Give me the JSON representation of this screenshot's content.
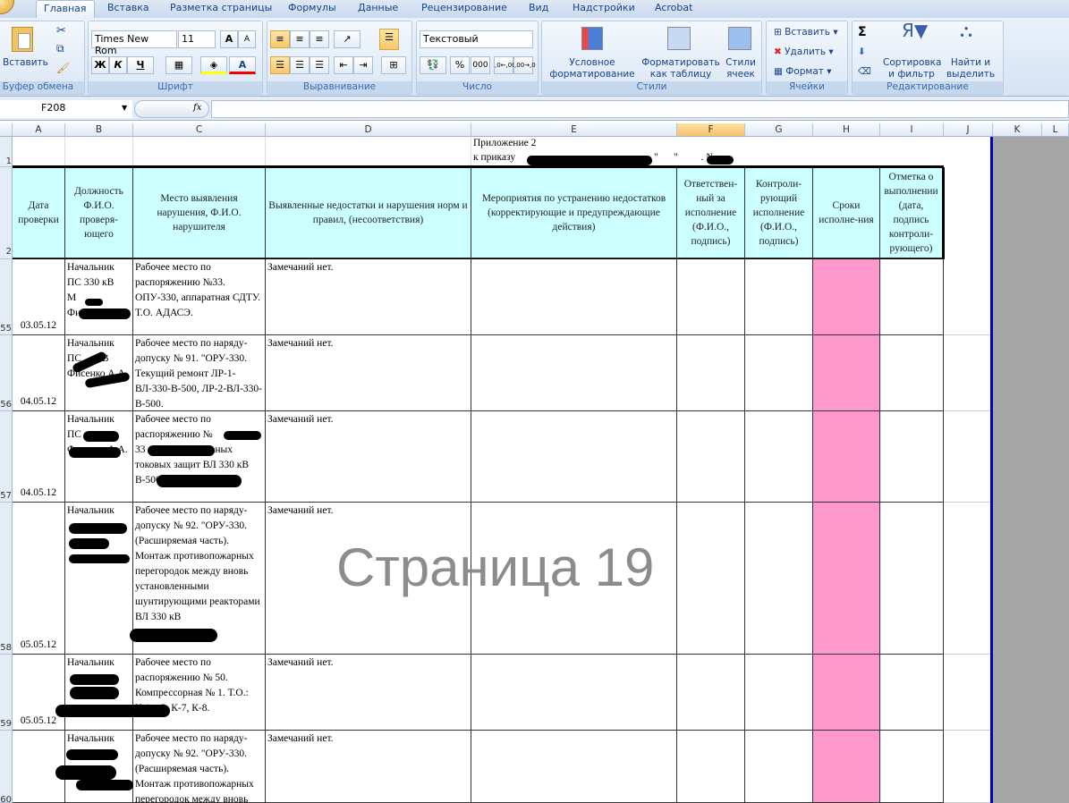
{
  "ribbon_tabs": [
    "Главная",
    "Вставка",
    "Разметка страницы",
    "Формулы",
    "Данные",
    "Рецензирование",
    "Вид",
    "Надстройки",
    "Acrobat"
  ],
  "active_tab": "Главная",
  "clipboard": {
    "paste": "Вставить",
    "group": "Буфер обмена"
  },
  "font": {
    "name": "Times New Rom",
    "size": "11",
    "bold": "Ж",
    "italic": "К",
    "underline": "Ч",
    "grow": "A",
    "shrink": "A",
    "color": "A",
    "group": "Шрифт"
  },
  "alignment": {
    "group": "Выравнивание"
  },
  "number": {
    "format": "Текстовый",
    "percent": "%",
    "thousands": "000",
    "inc_dec": ",0←,00",
    "dec_dec": ",00→,0",
    "group": "Число"
  },
  "styles": {
    "conditional": "Условное форматирование",
    "format_table": "Форматировать как таблицу",
    "cell_styles": "Стили ячеек",
    "group": "Стили"
  },
  "cells": {
    "insert": "Вставить",
    "delete": "Удалить",
    "format": "Формат",
    "group": "Ячейки"
  },
  "editing": {
    "sum": "Σ",
    "sort": "Сортировка и фильтр",
    "find": "Найти и выделить",
    "group": "Редактирование"
  },
  "formula_bar": {
    "name_box": "F208",
    "fx": "fx",
    "value": ""
  },
  "columns": [
    "A",
    "B",
    "C",
    "D",
    "E",
    "F",
    "G",
    "H",
    "I",
    "J",
    "K",
    "L"
  ],
  "selected_column": "F",
  "row1": {
    "num": "1",
    "line1": "Приложение 2",
    "line2": "к  приказу",
    "line2_tail": "\"      \"         . №"
  },
  "header_row": {
    "num": "2",
    "cols": [
      "Дата проверки",
      "Должность Ф.И.О. проверя-ющего",
      "Место выявления нарушения, Ф.И.О. нарушителя",
      "Выявленные недостатки и нарушения норм и правил, (несоответствия)",
      "Мероприятия по устранению недостатков (корректирующие и предупреждающие действия)",
      "Ответствен-ный за исполнение (Ф.И.О., подпись)",
      "Контроли-рующий исполнение (Ф.И.О., подпись)",
      "Сроки исполне-ния",
      "Отметка о выполнении (дата, подпись контроли-рующего)"
    ]
  },
  "rows": [
    {
      "num": "55",
      "date": "03.05.12",
      "who": "Начальник ПС 330 кВ М         Фисенко А.А.",
      "place": "Рабочее место по распоряжению №33. ОПУ-330, аппаратная СДТУ. Т.О. АДАСЭ.",
      "finding": "Замечаний нет."
    },
    {
      "num": "56",
      "date": "04.05.12",
      "who": "Начальник ПС      кВ   Фисенко А.А.",
      "place": "Рабочее место по наряду-допуску № 91. \"ОРУ-330. Текущий ремонт ЛР-1-ВЛ-330-В-500, ЛР-2-ВЛ-330-В-500.",
      "finding": "Замечаний нет."
    },
    {
      "num": "57",
      "date": "04.05.12",
      "who": "Начальник ПС     Фисенко А.А.",
      "place": "Рабочее место по распоряжению №        33                резервных токовых защит ВЛ 330 кВ В-500 -                     \"О\".",
      "finding": "Замечаний нет."
    },
    {
      "num": "58",
      "date": "05.05.12",
      "who": "Начальник",
      "place": "Рабочее место по наряду-допуску № 92. \"ОРУ-330. (Расширяемая часть). Монтаж противопожарных перегородок между вновь установленными шунтирующими реакторами ВЛ 330 кВ",
      "finding": "Замечаний нет."
    },
    {
      "num": "59",
      "date": "05.05.12",
      "who": "Начальник",
      "place": "Рабочее место по распоряжению № 50. Компрессорная № 1. Т.О.: К-1    2, К-7, К-8.",
      "finding": "Замечаний нет."
    },
    {
      "num": "60",
      "date": "",
      "who": "Начальник",
      "place": "Рабочее место по наряду-допуску № 92. \"ОРУ-330. (Расширяемая часть). Монтаж противопожарных перегородок между вновь",
      "finding": "Замечаний нет."
    }
  ],
  "page_watermark": "Страница 19",
  "colors": {
    "header_fill": "#ccffff",
    "deadline_fill": "#ff99cc",
    "page_break": "#0000c0"
  }
}
